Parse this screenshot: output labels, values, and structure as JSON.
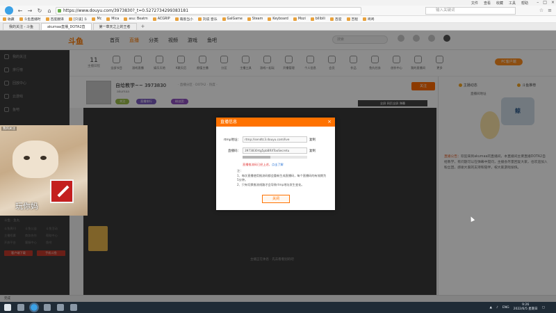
{
  "browser": {
    "menu": [
      "文件",
      "查看",
      "收藏",
      "工具",
      "帮助"
    ],
    "url": "https://www.douyu.com/3973830?_t=0.5272734299383181",
    "search_placeholder": "输入关键词",
    "bookmarks": [
      "收藏",
      "斗鱼直播时",
      "百度翻译",
      "[只读] 斗",
      "Mc",
      "Mica",
      "asu: Beatm",
      "ACGRIP",
      "萌兽当小",
      "刘说 音乐",
      "GalGame",
      "Steam",
      "Keyboard",
      "Mozi",
      "bilibili",
      "百度",
      "吉程",
      "咚咚"
    ],
    "tabs": [
      {
        "label": "我的关注 - 斗鱼",
        "active": false
      },
      {
        "label": "akumaa直播_DOTA2直",
        "active": true
      },
      {
        "label": "第一章天之上的王者",
        "active": false
      }
    ],
    "status": "完成"
  },
  "douyu": {
    "logo": "斗鱼",
    "nav": [
      "首页",
      "直播",
      "分类",
      "视频",
      "游戏",
      "鱼吧"
    ],
    "search_placeholder": "搜索",
    "categories": [
      {
        "label": "主播日程",
        "icon": "calendar-icon"
      },
      {
        "label": "全部节目",
        "icon": "grid-icon"
      },
      {
        "label": "游戏直播",
        "icon": "gamepad-icon"
      },
      {
        "label": "娱乐天地",
        "icon": "mic-icon"
      },
      {
        "label": "K歌天后",
        "icon": "music-icon"
      },
      {
        "label": "颜值主播",
        "icon": "face-icon"
      },
      {
        "label": "分区",
        "icon": "folder-icon"
      },
      {
        "label": "主播工具",
        "icon": "tool-icon"
      },
      {
        "label": "游戏一起玩",
        "icon": "joystick-icon"
      },
      {
        "label": "开播管理",
        "icon": "broadcast-icon"
      },
      {
        "label": "个人信息",
        "icon": "user-icon"
      },
      {
        "label": "会员",
        "icon": "vip-icon"
      },
      {
        "label": "作品",
        "icon": "film-icon"
      },
      {
        "label": "鱼丸任务",
        "icon": "task-icon"
      },
      {
        "label": "创作中心",
        "icon": "pen-icon"
      },
      {
        "label": "我的直播间",
        "icon": "home-icon"
      },
      {
        "label": "更多",
        "icon": "more-icon"
      }
    ],
    "date_day": "11",
    "date_sub": "主播日程",
    "pc_button": "PC客户端",
    "sidebar": [
      "我的关注",
      "排行榜",
      "回放中心",
      "云游戏",
      "鱼吧"
    ],
    "sidebar_lower_caption": "斗鱼 · 鱼丸",
    "sidebar_grid": [
      "斗鱼周刊",
      "斗鱼公益",
      "斗鱼活动",
      "主播招募",
      "商务合作",
      "帮助中心",
      "开放平台",
      "客服中心",
      "鱼吧"
    ],
    "sidebar_buttons": [
      "客户端下载",
      "手机斗鱼"
    ],
    "room": {
      "title": "自给教学~~ 3973830",
      "subtitle": "· 直播分区 · DOTA2 · 热度 ·",
      "owner": "akumaa",
      "badges": [
        "关注",
        "直播排行",
        "粉丝团"
      ],
      "follow_label": "关注",
      "video_tools": "全屏 网页全屏 弹幕",
      "video_hint": "主播正在休息 · 先去看看别的吧",
      "gift_label": "礼物"
    },
    "right_panel": {
      "tabs": [
        "主播动态",
        "斗鱼推荐"
      ],
      "address": "直播间地址",
      "mascot": "鲸",
      "notice_title": "直播公告：",
      "notice": "欢迎来到akumaa的直播间，本直播间主要直播DOTA2自给教学，有问题可以在弹幕中提问，主播会尽量回复大家，也欢迎加入粉丝团，感谢大家的支持和陪伴，祝大家游戏愉快。"
    }
  },
  "overlay": {
    "follow_tag": "我的关注",
    "caption": "玩你妈"
  },
  "modal": {
    "title": "直播信息",
    "rtmp_label": "rtmp地址：",
    "rtmp_value": "rtmp://sendtc3.douyu.com/live",
    "code_label": "直播码：",
    "code_value": "3973830rtg5pbBRXTooSecretu",
    "copy": "复制",
    "warn": "直播推流码已经上述，",
    "warn_link": "点击了解",
    "notes_title": "注：",
    "notes": [
      "1、每次直播使用推流码都会重新生成直播码，每个直播码的有效期为5分钟。",
      "2、只有切换推流线路才会导致rtmp地址发生变化。"
    ],
    "close": "关闭"
  },
  "taskbar": {
    "lang": "ENG",
    "time": "9:26",
    "date": "2022/6/5 星期日"
  }
}
